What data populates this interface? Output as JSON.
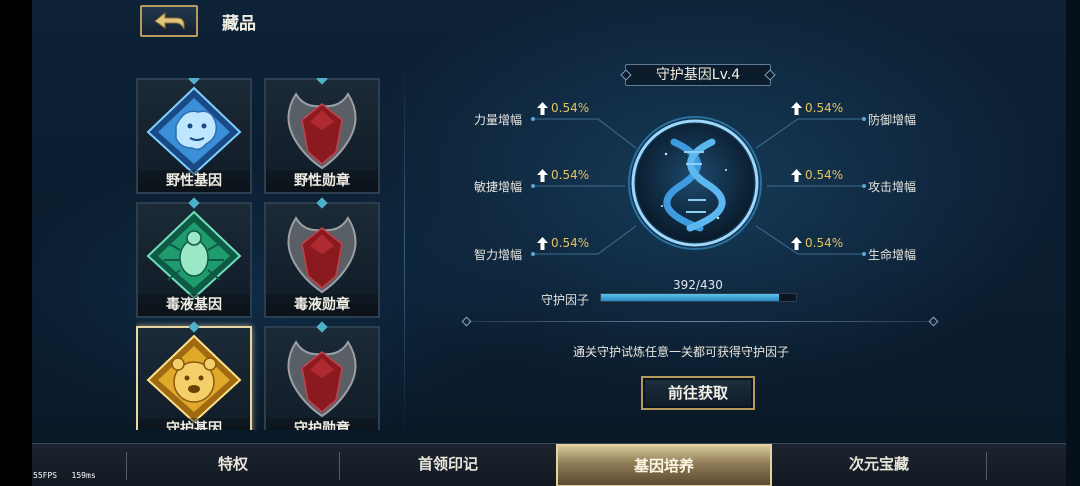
{
  "header": {
    "title": "藏品",
    "back_icon": "back-arrow-icon"
  },
  "collection": {
    "items": [
      {
        "label": "野性基因",
        "art": "beast-gene-icon",
        "color": "#3a8fd6",
        "selected": false
      },
      {
        "label": "野性勋章",
        "art": "red-medal-icon",
        "color": "#8a1a1f",
        "selected": false
      },
      {
        "label": "毒液基因",
        "art": "venom-gene-icon",
        "color": "#1f9b6e",
        "selected": false
      },
      {
        "label": "毒液勋章",
        "art": "red-medal-icon",
        "color": "#8a1a1f",
        "selected": false
      },
      {
        "label": "守护基因",
        "art": "bear-gene-icon",
        "color": "#e0a92a",
        "selected": true
      },
      {
        "label": "守护勋章",
        "art": "red-medal-icon",
        "color": "#8a1a1f",
        "selected": false
      }
    ]
  },
  "gene": {
    "title": "守护基因Lv.4",
    "stats_left": [
      {
        "name": "力量增幅",
        "value": "0.54%"
      },
      {
        "name": "敏捷增幅",
        "value": "0.54%"
      },
      {
        "name": "智力增幅",
        "value": "0.54%"
      }
    ],
    "stats_right": [
      {
        "name": "防御增幅",
        "value": "0.54%"
      },
      {
        "name": "攻击增幅",
        "value": "0.54%"
      },
      {
        "name": "生命增幅",
        "value": "0.54%"
      }
    ],
    "center_icon": "dna-icon",
    "factor": {
      "label": "守护因子",
      "text": "392/430",
      "current": 392,
      "max": 430
    },
    "hint": "通关守护试炼任意一关都可获得守护因子",
    "button": "前往获取"
  },
  "tabs": [
    {
      "label": "特权",
      "active": false
    },
    {
      "label": "首领印记",
      "active": false
    },
    {
      "label": "基因培养",
      "active": true
    },
    {
      "label": "次元宝藏",
      "active": false
    }
  ],
  "debug": {
    "fps": "55FPS",
    "ping": "159ms"
  },
  "colors": {
    "accent_gold": "#b59a5b",
    "stat_gold": "#e3c35f",
    "progress": "#3aa6da"
  }
}
